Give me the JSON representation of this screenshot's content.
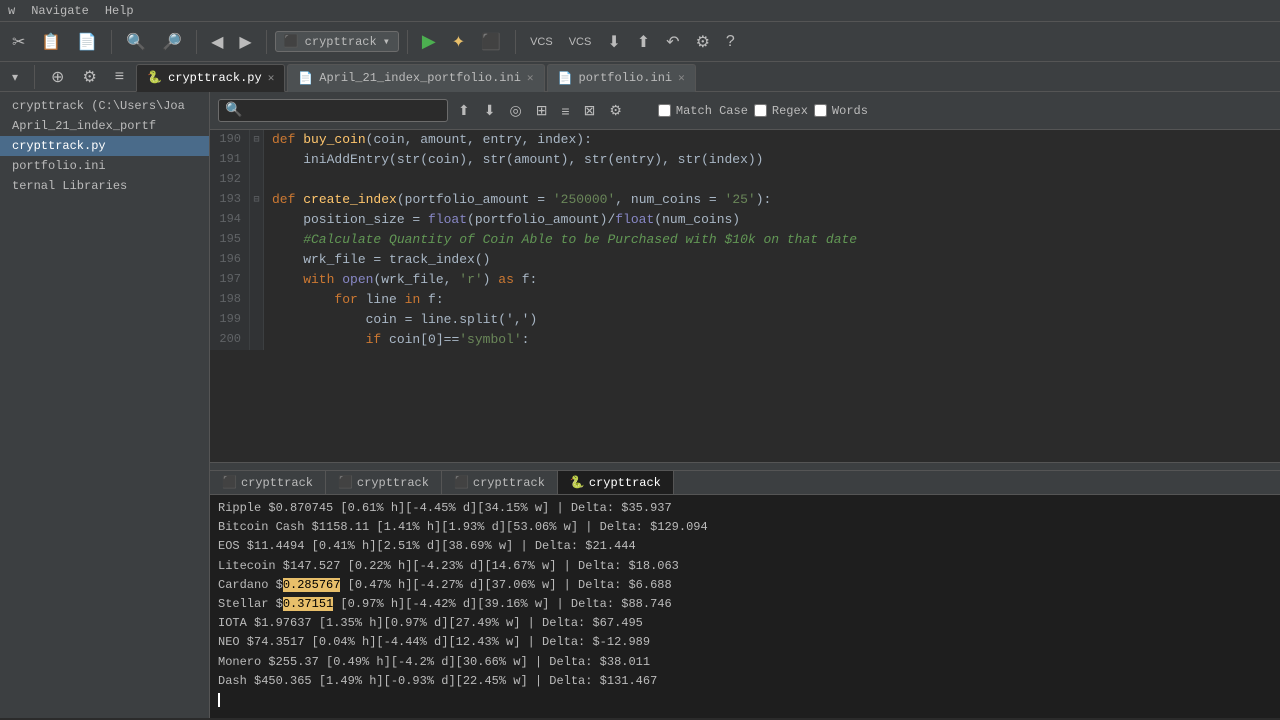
{
  "menubar": {
    "items": [
      "w",
      "Navigate",
      "Help"
    ]
  },
  "toolbar": {
    "buttons": [
      "✂",
      "📋",
      "📄",
      "🔍",
      "🔎"
    ],
    "nav_back": "◀",
    "nav_fwd": "▶",
    "project": "crypttrack",
    "run": "▶",
    "debug": "✦",
    "vcs_buttons": [
      "VCS",
      "VCS",
      "⬇",
      "⬆",
      "↶",
      "⚙",
      "?"
    ]
  },
  "second_toolbar": {
    "dropdown_arrow": "▾",
    "icons": [
      "⊕",
      "⚙",
      "≡"
    ]
  },
  "tabs": [
    {
      "id": "crypttrack-py",
      "label": "crypttrack.py",
      "type": "py",
      "active": true,
      "closable": true
    },
    {
      "id": "april-ini",
      "label": "April_21_index_portfolio.ini",
      "type": "ini",
      "active": false,
      "closable": true
    },
    {
      "id": "portfolio-ini",
      "label": "portfolio.ini",
      "type": "ini",
      "active": false,
      "closable": true
    }
  ],
  "sidebar": {
    "items": [
      {
        "label": "crypttrack (C:\\Users\\Joa",
        "active": false,
        "bold": false
      },
      {
        "label": "April_21_index_portf",
        "active": false,
        "bold": false
      },
      {
        "label": "crypttrack.py",
        "active": true,
        "bold": false
      },
      {
        "label": "portfolio.ini",
        "active": false,
        "bold": false
      },
      {
        "label": "ternal Libraries",
        "active": false,
        "bold": false
      }
    ]
  },
  "search": {
    "placeholder": "",
    "value": "",
    "search_icon": "🔍",
    "match_case_label": "Match Case",
    "regex_label": "Regex",
    "words_label": "Words",
    "match_case_checked": false,
    "regex_checked": false,
    "words_checked": false
  },
  "code": {
    "lines": [
      {
        "num": 190,
        "fold": "⊟",
        "content": "def buy_coin(coin, amount, entry, index):"
      },
      {
        "num": 191,
        "fold": "",
        "content": "    iniAddEntry(str(coin), str(amount), str(entry), str(index))"
      },
      {
        "num": 192,
        "fold": "",
        "content": ""
      },
      {
        "num": 193,
        "fold": "⊟",
        "content": "def create_index(portfolio_amount = '250000', num_coins = '25'):"
      },
      {
        "num": 194,
        "fold": "",
        "content": "    position_size = float(portfolio_amount)/float(num_coins)"
      },
      {
        "num": 195,
        "fold": "",
        "content": "    #Calculate Quantity of Coin Able to be Purchased with $10k on that date"
      },
      {
        "num": 196,
        "fold": "",
        "content": "    wrk_file = track_index()"
      },
      {
        "num": 197,
        "fold": "",
        "content": "    with open(wrk_file, 'r') as f:"
      },
      {
        "num": 198,
        "fold": "",
        "content": "        for line in f:"
      },
      {
        "num": 199,
        "fold": "",
        "content": "            coin = line.split(',')"
      },
      {
        "num": 200,
        "fold": "",
        "content": "            if coin[0]=='symbol':"
      }
    ]
  },
  "bottom_tabs": [
    {
      "label": "crypttrack",
      "active": false,
      "icon": "⬛"
    },
    {
      "label": "crypttrack",
      "active": false,
      "icon": "⬛"
    },
    {
      "label": "crypttrack",
      "active": false,
      "icon": "⬛"
    },
    {
      "label": "crypttrack",
      "active": true,
      "icon": "🐍"
    }
  ],
  "output": [
    {
      "text": "Ripple $0.870745 [0.61% h][-4.45% d][34.15% w] | Delta: $35.937",
      "highlight": null
    },
    {
      "text": "Bitcoin Cash $1158.11 [1.41% h][1.93% d][53.06% w] | Delta: $129.094",
      "highlight": null
    },
    {
      "text": "EOS $11.4494 [0.41% h][2.51% d][38.69% w] | Delta: $21.444",
      "highlight": null
    },
    {
      "text": "Litecoin $147.527 [0.22% h][-4.23% d][14.67% w] | Delta: $18.063",
      "highlight": null
    },
    {
      "text": "Cardano $0.285767 [0.47% h][-4.27% d][37.06% w] | Delta: $6.688",
      "highlight": [
        7,
        15
      ]
    },
    {
      "text": "Stellar $0.37151 [0.97% h][-4.42% d][39.16% w] | Delta: $88.746",
      "highlight": [
        8,
        15
      ]
    },
    {
      "text": "IOTA $1.97637 [1.35% h][0.97% d][27.49% w] | Delta: $67.495",
      "highlight": null
    },
    {
      "text": "NEO $74.3517 [0.04% h][-4.44% d][12.43% w] | Delta: $-12.989",
      "highlight": null
    },
    {
      "text": "Monero $255.37 [0.49% h][-4.2% d][30.66% w] | Delta: $38.011",
      "highlight": null
    },
    {
      "text": "Dash $450.365 [1.49% h][-0.93% d][22.45% w] | Delta: $131.467",
      "highlight": null
    }
  ]
}
